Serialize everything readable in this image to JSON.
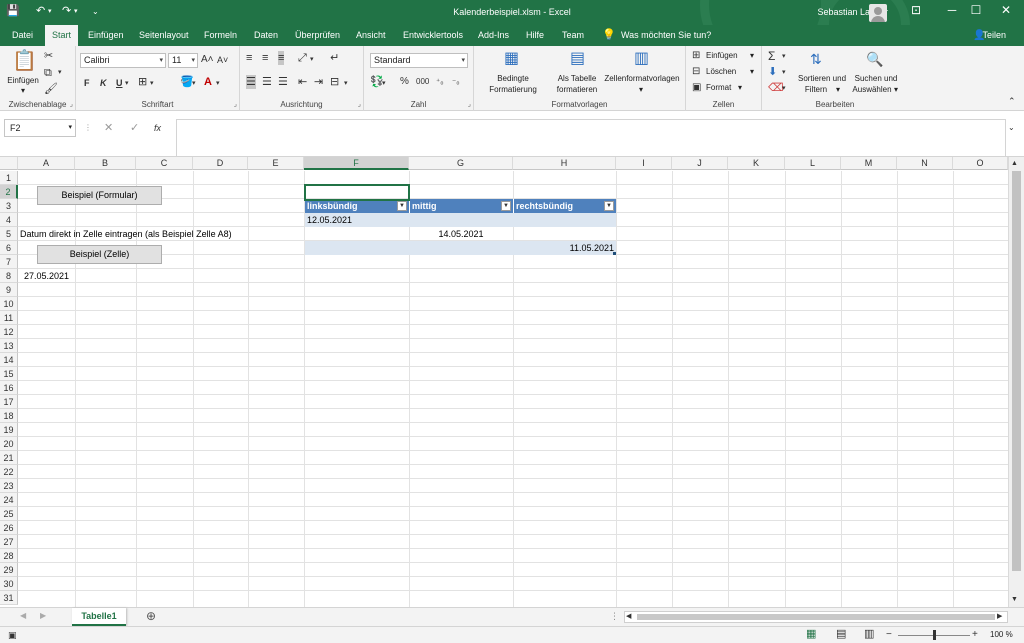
{
  "window": {
    "title": "Kalenderbeispiel.xlsm  -  Excel",
    "user": "Sebastian Langer"
  },
  "ribbon_tabs": [
    "Datei",
    "Start",
    "Einfügen",
    "Seitenlayout",
    "Formeln",
    "Daten",
    "Überprüfen",
    "Ansicht",
    "Entwicklertools",
    "Add-Ins",
    "Hilfe",
    "Team"
  ],
  "tellme": "Was möchten Sie tun?",
  "share": "Teilen",
  "clipboard": {
    "paste": "Einfügen",
    "label": "Zwischenablage"
  },
  "font": {
    "name": "Calibri",
    "size": "11",
    "bold": "F",
    "italic": "K",
    "underline": "U",
    "label": "Schriftart"
  },
  "alignment": {
    "label": "Ausrichtung"
  },
  "number": {
    "format": "Standard",
    "percent": "%",
    "thousands": "000",
    "label": "Zahl"
  },
  "styles": {
    "conditional_1": "Bedingte",
    "conditional_2": "Formatierung",
    "table_1": "Als Tabelle",
    "table_2": "formatieren",
    "cell_styles": "Zellenformatvorlagen",
    "label": "Formatvorlagen"
  },
  "cells": {
    "insert": "Einfügen",
    "delete": "Löschen",
    "format": "Format",
    "label": "Zellen"
  },
  "editing": {
    "sort_1": "Sortieren und",
    "sort_2": "Filtern",
    "find_1": "Suchen und",
    "find_2": "Auswählen",
    "label": "Bearbeiten"
  },
  "formula_bar": {
    "name_box": "F2",
    "cancel": "✕",
    "enter": "✓",
    "fx": "fx",
    "content": ""
  },
  "columns": [
    "A",
    "B",
    "C",
    "D",
    "E",
    "F",
    "G",
    "H",
    "I",
    "J",
    "K",
    "L",
    "M",
    "N",
    "O"
  ],
  "rows": [
    "1",
    "2",
    "3",
    "4",
    "5",
    "6",
    "7",
    "8",
    "9",
    "10",
    "11",
    "12",
    "13",
    "14",
    "15",
    "16",
    "17",
    "18",
    "19",
    "20",
    "21",
    "22",
    "23",
    "24",
    "25",
    "26",
    "27",
    "28",
    "29",
    "30",
    "31"
  ],
  "sheet": {
    "btn_formular": "Beispiel (Formular)",
    "btn_zelle": "Beispiel (Zelle)",
    "a5": "Datum direkt in Zelle eintragen (als Beispiel Zelle A8)",
    "a8": "27.05.2021",
    "table_headers": [
      "linksbündig",
      "mittig",
      "rechtsbündig"
    ],
    "f4": "12.05.2021",
    "g5": "14.05.2021",
    "h6": "11.05.2021"
  },
  "sheet_tabs": [
    "Tabelle1"
  ],
  "status": {
    "zoom": "100 %"
  },
  "colors": {
    "accent": "#217346",
    "table_header": "#4f81bd",
    "table_band": "#dce6f1"
  }
}
